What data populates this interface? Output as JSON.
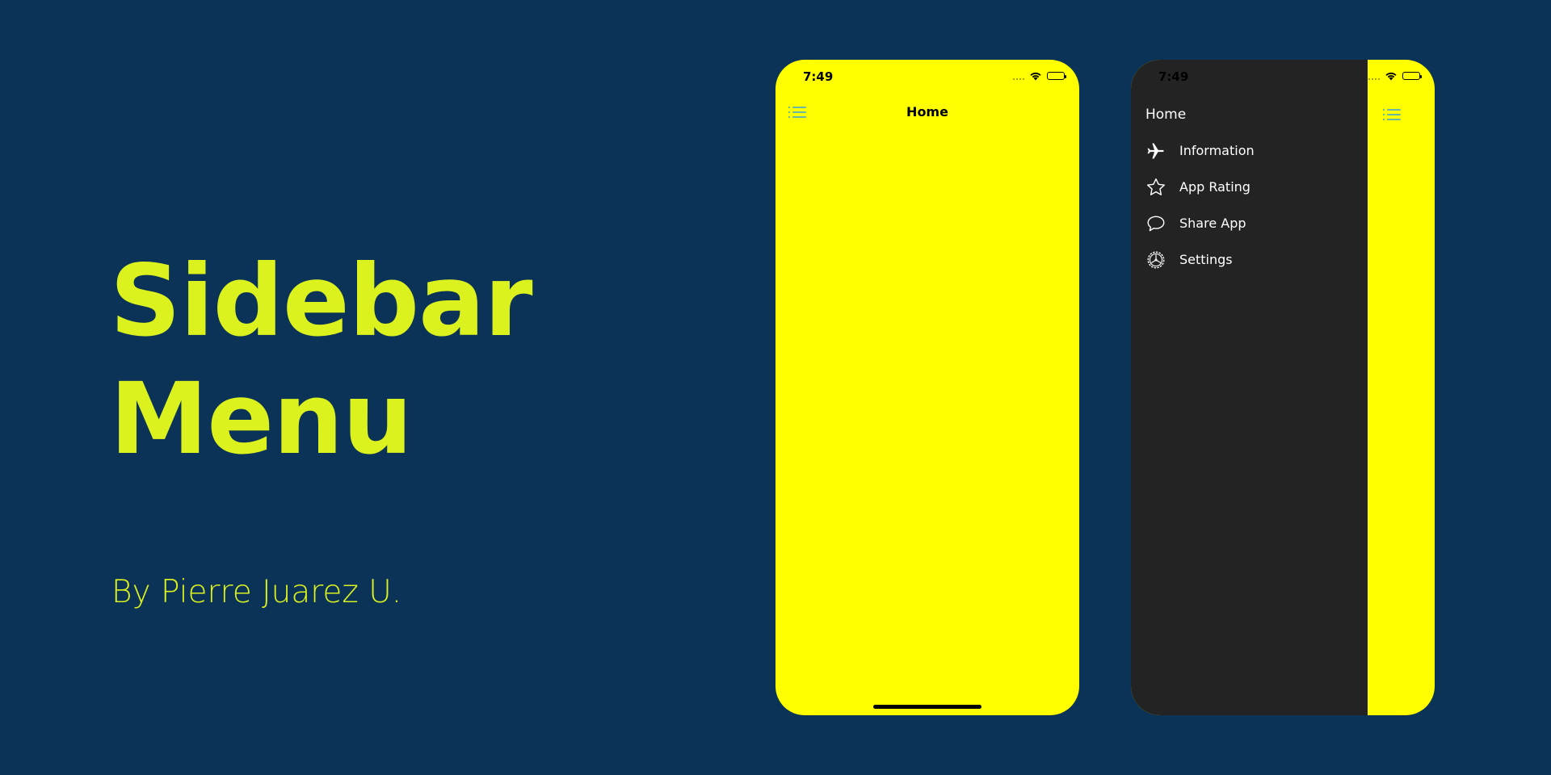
{
  "hero": {
    "title_line1": "Sidebar",
    "title_line2": "Menu",
    "author": "By Pierre Juarez U."
  },
  "phone_home": {
    "status_time": "7:49",
    "nav_title": "Home",
    "background": "#ffff00"
  },
  "phone_sidebar": {
    "status_time": "7:49",
    "sidebar_title": "Home",
    "items": [
      {
        "label": "Information",
        "icon": "airplane-icon"
      },
      {
        "label": "App Rating",
        "icon": "star-icon"
      },
      {
        "label": "Share App",
        "icon": "speech-bubble-icon"
      },
      {
        "label": "Settings",
        "icon": "gear-icon"
      }
    ],
    "sidebar_bg": "#232323"
  },
  "colors": {
    "page_bg": "#0b3358",
    "accent": "#dcf21e",
    "menu_icon": "#3aa0d8"
  }
}
